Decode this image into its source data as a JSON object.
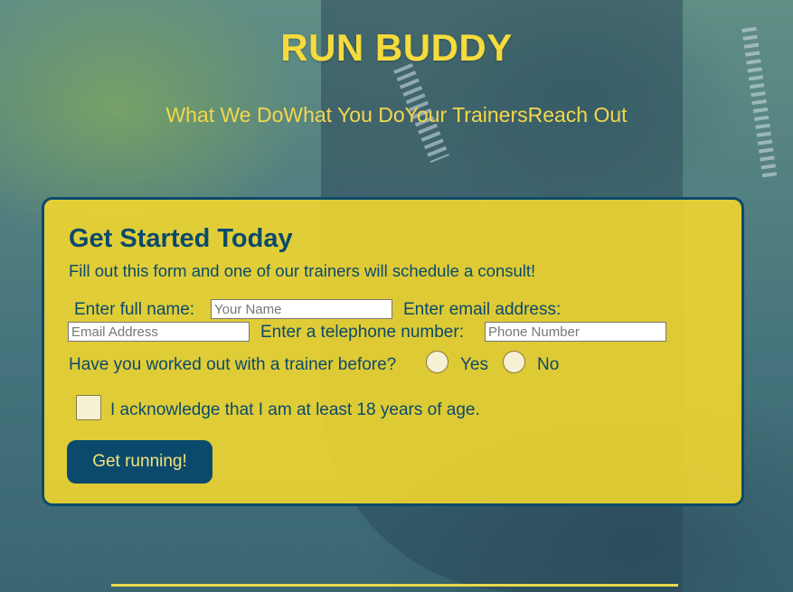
{
  "header": {
    "title": "RUN BUDDY",
    "nav": [
      "What We Do",
      "What You Do",
      "Your Trainers",
      "Reach Out"
    ]
  },
  "form": {
    "heading": "Get Started Today",
    "subtitle": "Fill out this form and one of our trainers will schedule a consult!",
    "name_label": "Enter full name:",
    "name_placeholder": "Your Name",
    "email_label": "Enter email address:",
    "email_placeholder": "Email Address",
    "phone_label": "Enter a telephone number:",
    "phone_placeholder": "Phone Number",
    "trainer_question": "Have you worked out with a trainer before?",
    "yes_label": "Yes",
    "no_label": "No",
    "ack_label": "I acknowledge that I am at least 18 years of age.",
    "submit_label": "Get running!"
  },
  "colors": {
    "brand_yellow": "#f5dc3c",
    "brand_blue": "#0b4a6c"
  }
}
